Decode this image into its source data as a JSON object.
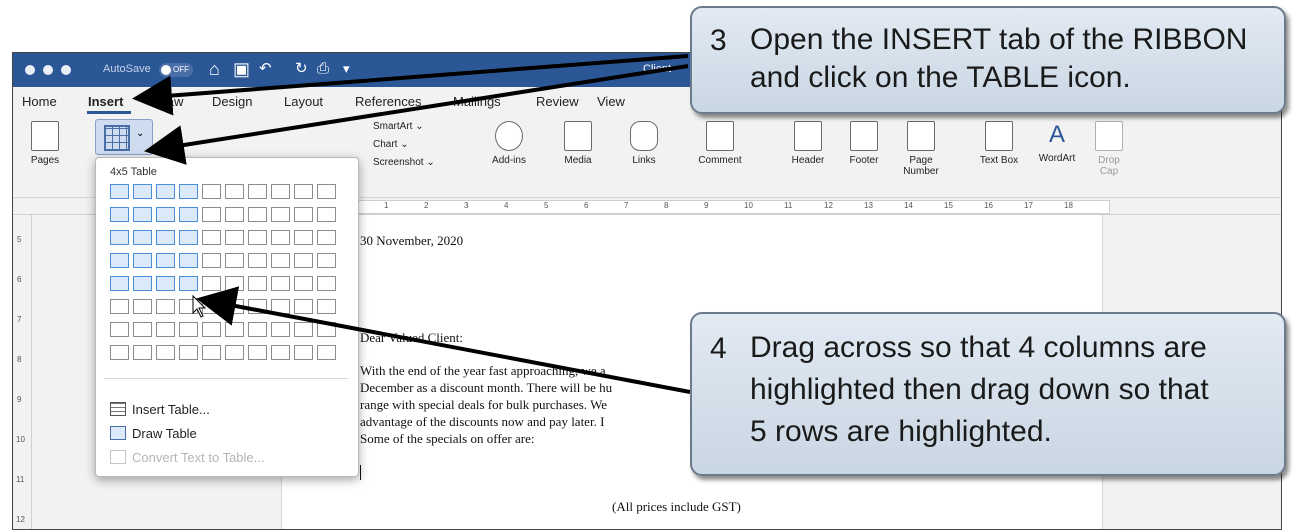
{
  "window": {
    "autosave_label": "AutoSave",
    "autosave_state": "OFF",
    "doc_title": "Client",
    "title_icons": [
      "home-icon",
      "save-icon",
      "undo-icon",
      "redo-icon",
      "print-icon",
      "customize-icon"
    ]
  },
  "tabs": [
    "Home",
    "Insert",
    "Draw",
    "Design",
    "Layout",
    "References",
    "Mailings",
    "Review",
    "View"
  ],
  "active_tab": "Insert",
  "ribbon": {
    "pages": "Pages",
    "smartart": "SmartArt ⌄",
    "chart": "Chart ⌄",
    "screenshot": "Screenshot ⌄",
    "addins": "Add-ins",
    "media": "Media",
    "links": "Links",
    "comment": "Comment",
    "header": "Header",
    "footer": "Footer",
    "page_number": "Page Number",
    "textbox": "Text Box",
    "wordart": "WordArt",
    "dropcap": "Drop Cap"
  },
  "table_menu": {
    "title": "4x5 Table",
    "grid_cols": 10,
    "grid_rows": 8,
    "highlight_cols": 4,
    "highlight_rows": 5,
    "insert_table": "Insert Table...",
    "draw_table": "Draw Table",
    "convert": "Convert Text to Table..."
  },
  "document": {
    "date": "30 November, 2020",
    "salutation": "Dear Valued Client:",
    "line1": "With the end of the year fast approaching, we a",
    "line2": "December as a discount month. There will be hu",
    "line3": "range with special deals for bulk purchases. We",
    "line4": "advantage of the discounts now and pay later. I",
    "line5": "Some of the specials on offer are:",
    "prices_note": "(All prices include GST)"
  },
  "ruler_numbers": [
    "1",
    "2",
    "3",
    "4",
    "5",
    "6",
    "7",
    "8",
    "9",
    "10",
    "11",
    "12",
    "13",
    "14",
    "15",
    "16",
    "17",
    "18"
  ],
  "vruler_numbers": [
    "5",
    "6",
    "7",
    "8",
    "9",
    "10",
    "11",
    "12"
  ],
  "callouts": {
    "c3_num": "3",
    "c3_line1": "Open the INSERT tab of the RIBBON",
    "c3_line2": "and click on the TABLE icon.",
    "c4_num": "4",
    "c4_line1": "Drag across so that 4 columns are",
    "c4_line2": "highlighted then drag down so that",
    "c4_line3": "5 rows are highlighted."
  },
  "colors": {
    "titlebar": "#2b5797",
    "highlight": "#dbe9fa",
    "callout": "#d5e0ec"
  }
}
